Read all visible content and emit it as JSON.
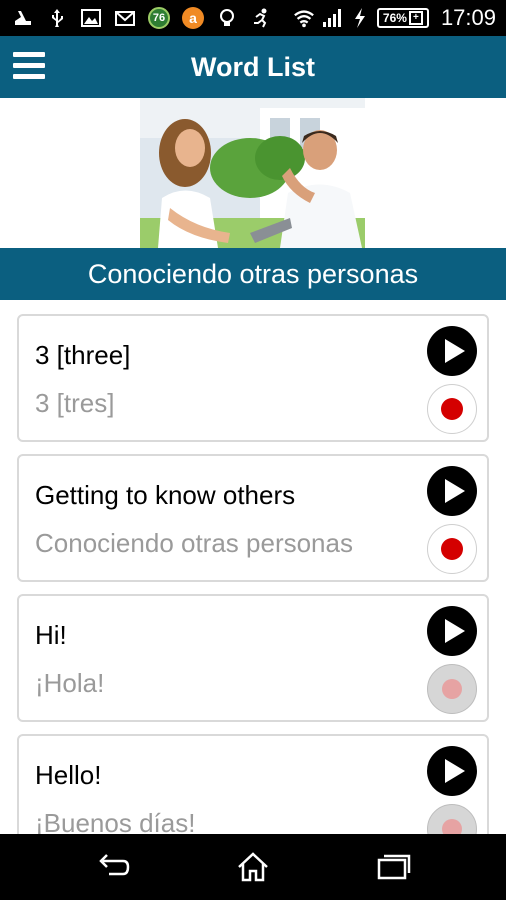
{
  "status_bar": {
    "notification_badge": "76",
    "battery_percent": "76%",
    "battery_plus": "+",
    "time": "17:09",
    "icons": [
      "drive-icon",
      "usb-icon",
      "image-icon",
      "mail-icon",
      "badge-76-icon",
      "orange-app-icon",
      "bulb-icon",
      "runner-icon",
      "wifi-icon",
      "signal-icon",
      "charging-icon",
      "battery-icon"
    ]
  },
  "app_bar": {
    "title": "Word List",
    "menu_icon": "hamburger-menu-icon"
  },
  "hero": {
    "image": "photo-two-people-talking"
  },
  "section": {
    "title": "Conociendo otras personas"
  },
  "words": [
    {
      "english": "3 [three]",
      "spanish": "3 [tres]",
      "record_enabled": true
    },
    {
      "english": "Getting to know others",
      "spanish": "Conociendo otras personas",
      "record_enabled": true
    },
    {
      "english": "Hi!",
      "spanish": "¡Hola!",
      "record_enabled": false
    },
    {
      "english": "Hello!",
      "spanish": "¡Buenos días!",
      "record_enabled": false
    }
  ],
  "nav_bar": {
    "icons": [
      "back-icon",
      "home-icon",
      "recent-apps-icon"
    ]
  },
  "colors": {
    "primary": "#0b5f80",
    "record": "#d40000",
    "secondary_text": "#9a9a9a"
  }
}
